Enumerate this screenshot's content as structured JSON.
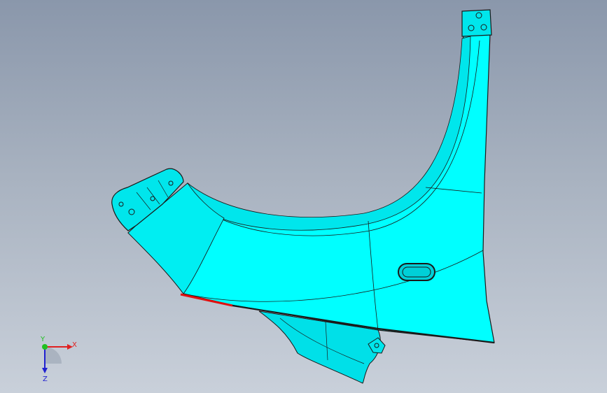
{
  "viewport": {
    "background_top": "#8a97ab",
    "background_bottom": "#c9d0da"
  },
  "model": {
    "part": "fender-panel",
    "face_color": "#00ffff",
    "shade_color": "#00d8e0",
    "edge_color": "#1a1a1a",
    "highlight_edge_color": "#e01010"
  },
  "triad": {
    "x_label": "X",
    "y_label": "Y",
    "z_label": "Z",
    "x_color": "#e02020",
    "y_color": "#20c020",
    "z_color": "#2020d0"
  }
}
